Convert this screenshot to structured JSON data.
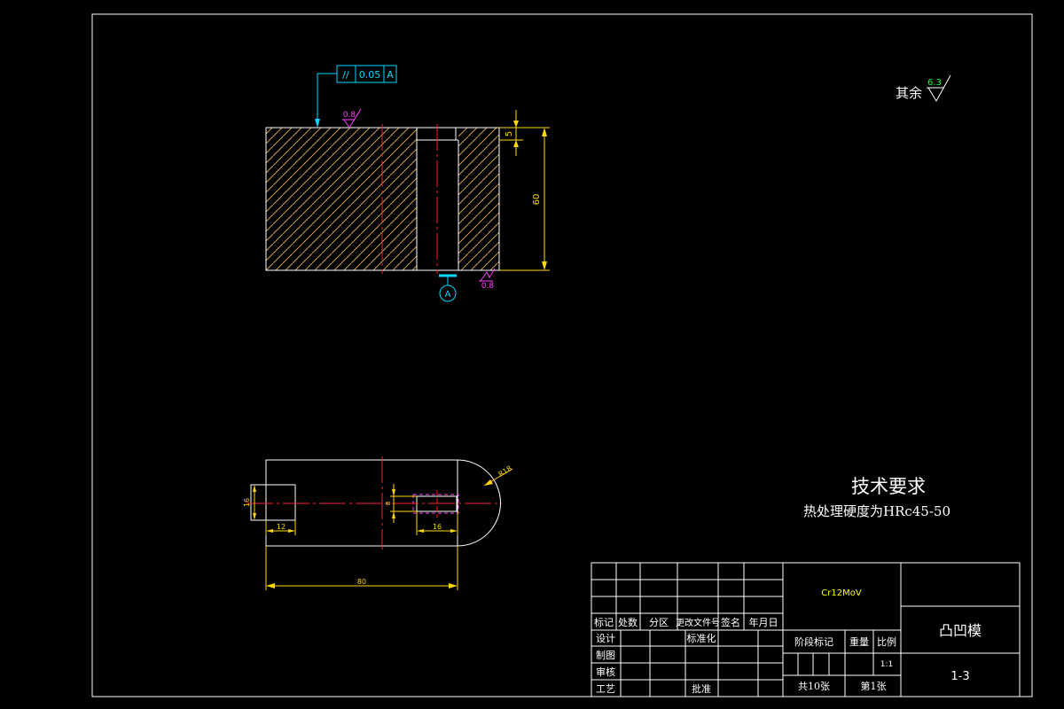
{
  "colors": {
    "background": "#000000",
    "outline": "#ffffff",
    "hatch": "#c8a050",
    "dimension": "#ffd700",
    "centerline": "#ff2020",
    "datum": "#00d8ff",
    "surface_magenta": "#ff40ff",
    "surface_green": "#00ff40",
    "material_text": "#ffff00"
  },
  "front_view": {
    "tolerance_frame": {
      "symbol": "//",
      "value": "0.05",
      "datum": "A"
    },
    "roughness_top": "0.8",
    "roughness_bottom": "0.8",
    "datum_label": "A",
    "dim_height": "60",
    "dim_step": "5"
  },
  "top_view": {
    "dim_total_length": "80",
    "dim_left_width": "12",
    "dim_left_height": "16",
    "dim_right_width": "16",
    "dim_small_height": "8",
    "dim_radius": "R18"
  },
  "rest_roughness": {
    "label": "其余",
    "value": "6.3"
  },
  "tech_requirements": {
    "title": "技术要求",
    "line1": "热处理硬度为HRc45-50"
  },
  "title_block": {
    "material": "Cr12MoV",
    "part_name": "凸凹模",
    "drawing_no": "1-3",
    "header_labels": [
      "标记",
      "处数",
      "分区",
      "更改文件号",
      "签名",
      "年月日"
    ],
    "design": "设计",
    "standardize": "标准化",
    "drafting": "制图",
    "review": "审核",
    "process": "工艺",
    "approve": "批准",
    "stage_mark": "阶段标记",
    "weight": "重量",
    "scale_label": "比例",
    "scale": "1:1",
    "sheets_total": "共10张",
    "sheet_no": "第1张"
  }
}
